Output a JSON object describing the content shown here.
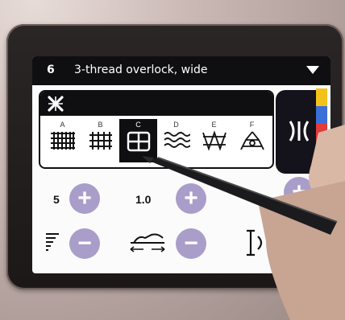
{
  "header": {
    "number": "6",
    "title": "3-thread overlock, wide"
  },
  "stitch_variants": [
    {
      "label": "A"
    },
    {
      "label": "B"
    },
    {
      "label": "C",
      "selected": true
    },
    {
      "label": "D"
    },
    {
      "label": "E"
    },
    {
      "label": "F"
    }
  ],
  "controls": {
    "width_value": "5",
    "length_value": "1.0"
  },
  "thread_colors": [
    "#f2c21b",
    "#3a6fd8",
    "#e23b3b",
    "#29b34a"
  ],
  "icons": {
    "header_left": "close-x-icon",
    "header_right": "dropdown-arrow-icon",
    "side_button": "mirror-icon",
    "width_icon": "stitch-width-icon",
    "length_icon": "stitch-length-icon",
    "tension_icon": "tension-icon"
  }
}
